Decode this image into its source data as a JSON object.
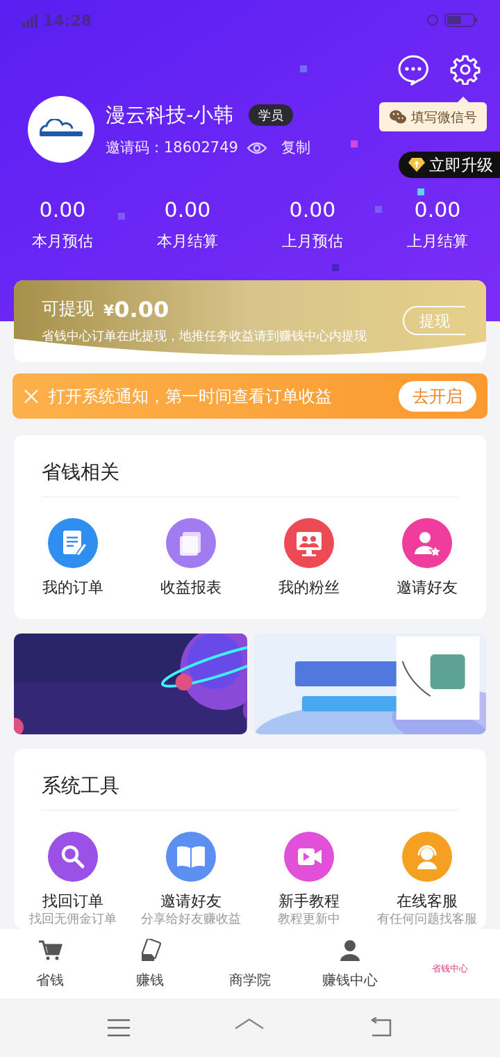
{
  "status_bar": {
    "time": "14:28"
  },
  "profile": {
    "name": "漫云科技-小韩",
    "badge": "学员",
    "invite_label": "邀请码：",
    "invite_code": "18602749",
    "copy": "复制",
    "wechat_tip": "填写微信号",
    "upgrade": "立即升级"
  },
  "stats": [
    {
      "value": "0.00",
      "label": "本月预估"
    },
    {
      "value": "0.00",
      "label": "本月结算"
    },
    {
      "value": "0.00",
      "label": "上月预估"
    },
    {
      "value": "0.00",
      "label": "上月结算"
    }
  ],
  "withdraw": {
    "label": "可提现",
    "currency": "¥",
    "amount": "0.00",
    "note": "省钱中心订单在此提现，地推任务收益请到赚钱中心内提现",
    "button": "提现"
  },
  "notice": {
    "text": "打开系统通知，第一时间查看订单收益",
    "button": "去开启"
  },
  "savings": {
    "title": "省钱相关",
    "items": [
      {
        "label": "我的订单"
      },
      {
        "label": "收益报表"
      },
      {
        "label": "我的粉丝"
      },
      {
        "label": "邀请好友"
      }
    ]
  },
  "tools": {
    "title": "系统工具",
    "items": [
      {
        "label": "找回订单",
        "sub": "找回无佣金订单"
      },
      {
        "label": "邀请好友",
        "sub": "分享给好友赚收益"
      },
      {
        "label": "新手教程",
        "sub": "教程更新中"
      },
      {
        "label": "在线客服",
        "sub": "有任何问题找客服"
      }
    ]
  },
  "tab_bar": [
    {
      "label": "省钱",
      "selected": false
    },
    {
      "label": "赚钱",
      "selected": false
    },
    {
      "label": "商学院",
      "selected": false
    },
    {
      "label": "赚钱中心",
      "selected": false
    },
    {
      "label": "省钱中心",
      "selected": true
    }
  ]
}
